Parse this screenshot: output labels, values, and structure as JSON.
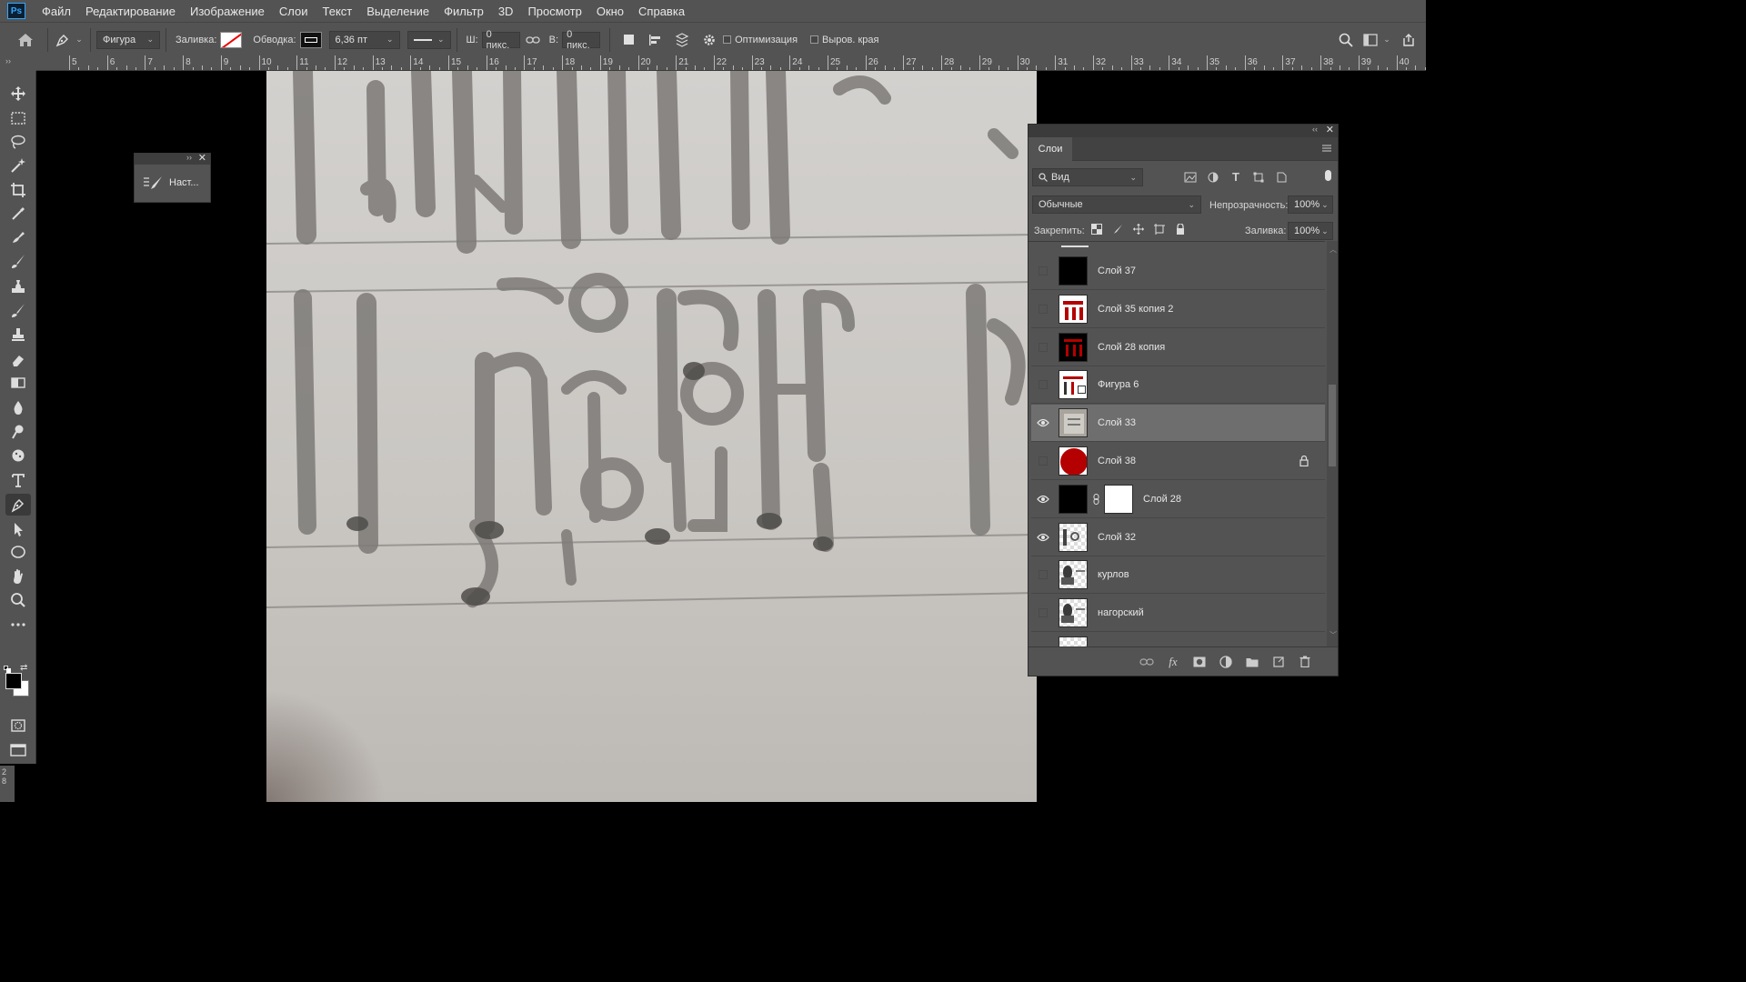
{
  "app": {
    "logo": "Ps"
  },
  "menu": [
    "Файл",
    "Редактирование",
    "Изображение",
    "Слои",
    "Текст",
    "Выделение",
    "Фильтр",
    "3D",
    "Просмотр",
    "Окно",
    "Справка"
  ],
  "options": {
    "shape_mode": "Фигура",
    "fill_label": "Заливка:",
    "stroke_label": "Обводка:",
    "stroke_size": "6,36 пт",
    "width_label": "Ш:",
    "width_value": "0 пикс.",
    "height_label": "В:",
    "height_value": "0 пикс.",
    "optimize_label": "Оптимизация",
    "align_edges_label": "Выров. края"
  },
  "ruler": {
    "labels": [
      "5",
      "6",
      "7",
      "8",
      "9",
      "10",
      "11",
      "12",
      "13",
      "14",
      "15",
      "16",
      "17",
      "18",
      "19",
      "20",
      "21",
      "22",
      "23",
      "24",
      "25",
      "26",
      "27",
      "28",
      "29",
      "30",
      "31",
      "32",
      "33",
      "34",
      "35",
      "36",
      "37",
      "38",
      "39",
      "40"
    ]
  },
  "mini_panel": {
    "label": "Наст..."
  },
  "status": {
    "zoom_fragment": "2\n8"
  },
  "layers_panel": {
    "title": "Слои",
    "filter_kind": "Вид",
    "blend_mode": "Обычные",
    "opacity_label": "Непрозрачность:",
    "opacity_value": "100%",
    "lock_label": "Закрепить:",
    "fill_label": "Заливка:",
    "fill_value": "100%",
    "layers": [
      {
        "name": "Слой 37",
        "visible": false,
        "selected": false,
        "thumb": "black"
      },
      {
        "name": "Слой 35 копия 2",
        "visible": false,
        "selected": false,
        "thumb": "red-text"
      },
      {
        "name": "Слой 28 копия",
        "visible": false,
        "selected": false,
        "thumb": "black-red"
      },
      {
        "name": "Фигура 6",
        "visible": false,
        "selected": false,
        "thumb": "red-text-link"
      },
      {
        "name": "Слой 33",
        "visible": true,
        "selected": true,
        "thumb": "photo"
      },
      {
        "name": "Слой 38",
        "visible": false,
        "selected": false,
        "thumb": "red-circle",
        "locked": true
      },
      {
        "name": "Слой 28",
        "visible": true,
        "selected": false,
        "thumb": "black-mask"
      },
      {
        "name": "Слой 32",
        "visible": true,
        "selected": false,
        "thumb": "transparent-text"
      },
      {
        "name": "курлов",
        "visible": false,
        "selected": false,
        "thumb": "transparent-portrait"
      },
      {
        "name": "нагорский",
        "visible": false,
        "selected": false,
        "thumb": "transparent-portrait"
      }
    ]
  },
  "colors": {
    "accent": "#31a8ff",
    "red": "#b40000",
    "panel": "#535353"
  }
}
